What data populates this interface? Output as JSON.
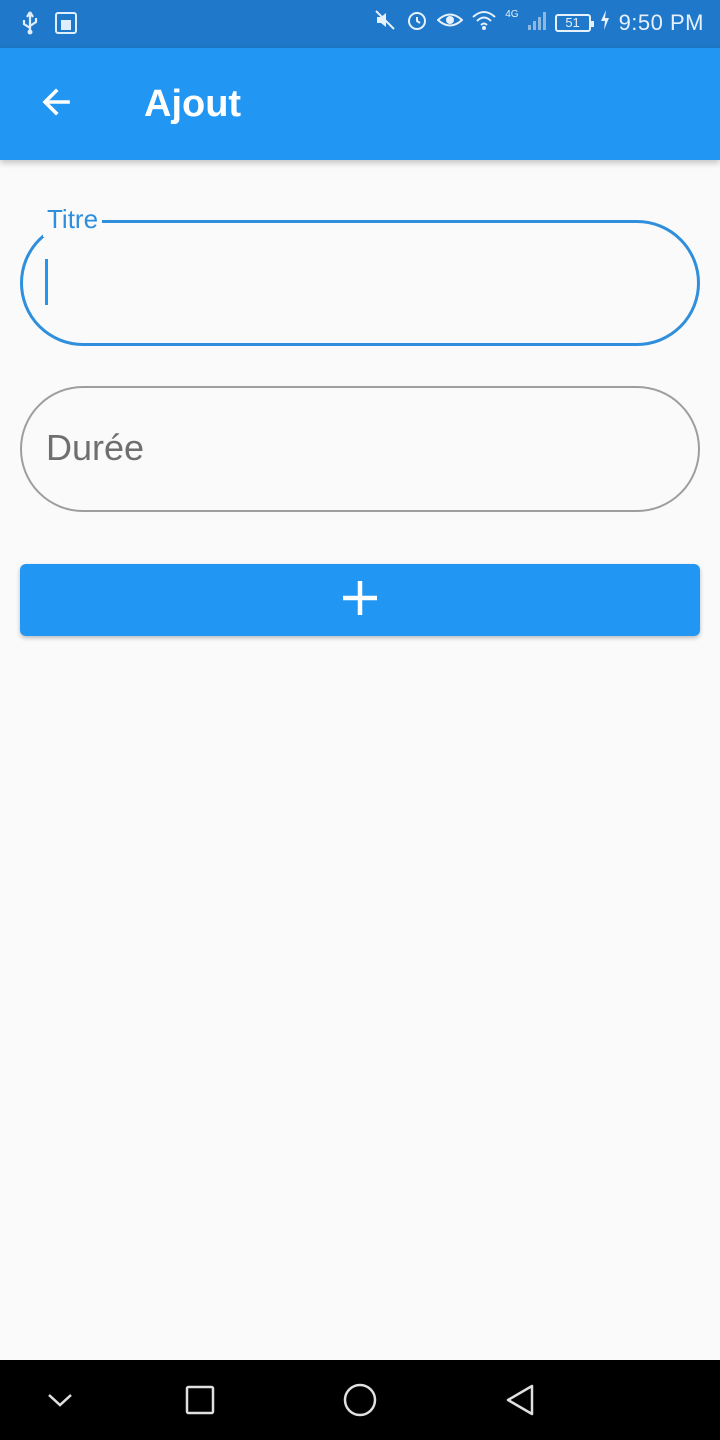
{
  "status_bar": {
    "time": "9:50 PM",
    "battery": "51",
    "network": "4G",
    "icons": [
      "usb-icon",
      "debug-icon",
      "mute-icon",
      "alarm-icon",
      "eye-icon",
      "wifi-icon",
      "signal-icon",
      "charging-icon"
    ]
  },
  "app_bar": {
    "title": "Ajout",
    "back_icon": "arrow-back-icon"
  },
  "form": {
    "title_field": {
      "label": "Titre",
      "value": ""
    },
    "duration_field": {
      "placeholder": "Durée",
      "value": ""
    },
    "add_button": {
      "icon": "plus-icon"
    }
  },
  "nav_bar": {
    "buttons": [
      "chevron-down-icon",
      "recents-icon",
      "home-icon",
      "back-icon"
    ]
  },
  "colors": {
    "primary": "#2196f3",
    "status_bar": "#1f78c9",
    "focus": "#2f8fdd",
    "background": "#fafafa"
  }
}
